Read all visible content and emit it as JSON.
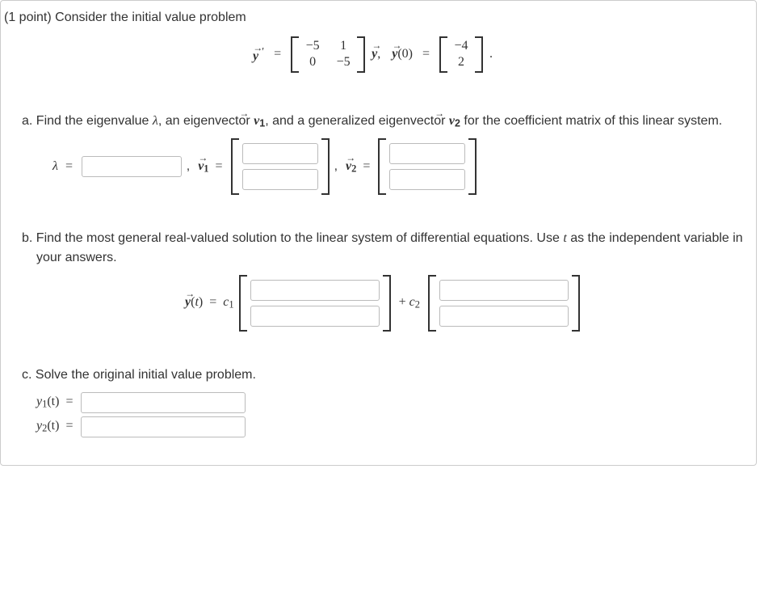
{
  "points": "(1 point)",
  "intro": "Consider the initial value problem",
  "matrix_eq": {
    "y_prime": "y",
    "A": [
      [
        "−5",
        "1"
      ],
      [
        "0",
        "−5"
      ]
    ],
    "y0_label": "y(0)",
    "y0_vec": [
      "−4",
      "2"
    ]
  },
  "partA": {
    "letter": "a.",
    "text_before_lambda": "Find the eigenvalue ",
    "lambda": "λ",
    "text_mid1": ", an eigenvector ",
    "v1": "v",
    "v1_sub": "1",
    "text_mid2": ", and a generalized eigenvector ",
    "v2": "v",
    "v2_sub": "2",
    "text_after": " for the coefficient matrix of this linear system.",
    "lambda_eq": "λ =",
    "v1_eq": "v",
    "v2_eq": "v",
    "eq": "="
  },
  "partB": {
    "letter": "b.",
    "text": "Find the most general real-valued solution to the linear system of differential equations. Use ",
    "t_var": "t",
    "text_after": " as the independent variable in your answers.",
    "y_of_t": "y(t)",
    "c1": "c",
    "c1_sub": "1",
    "plus": "+ ",
    "c2": "c",
    "c2_sub": "2"
  },
  "partC": {
    "letter": "c.",
    "text": "Solve the original initial value problem.",
    "y1": "y",
    "y1_sub": "1",
    "y2": "y",
    "y2_sub": "2",
    "of_t": "(t)",
    "eq": "="
  }
}
